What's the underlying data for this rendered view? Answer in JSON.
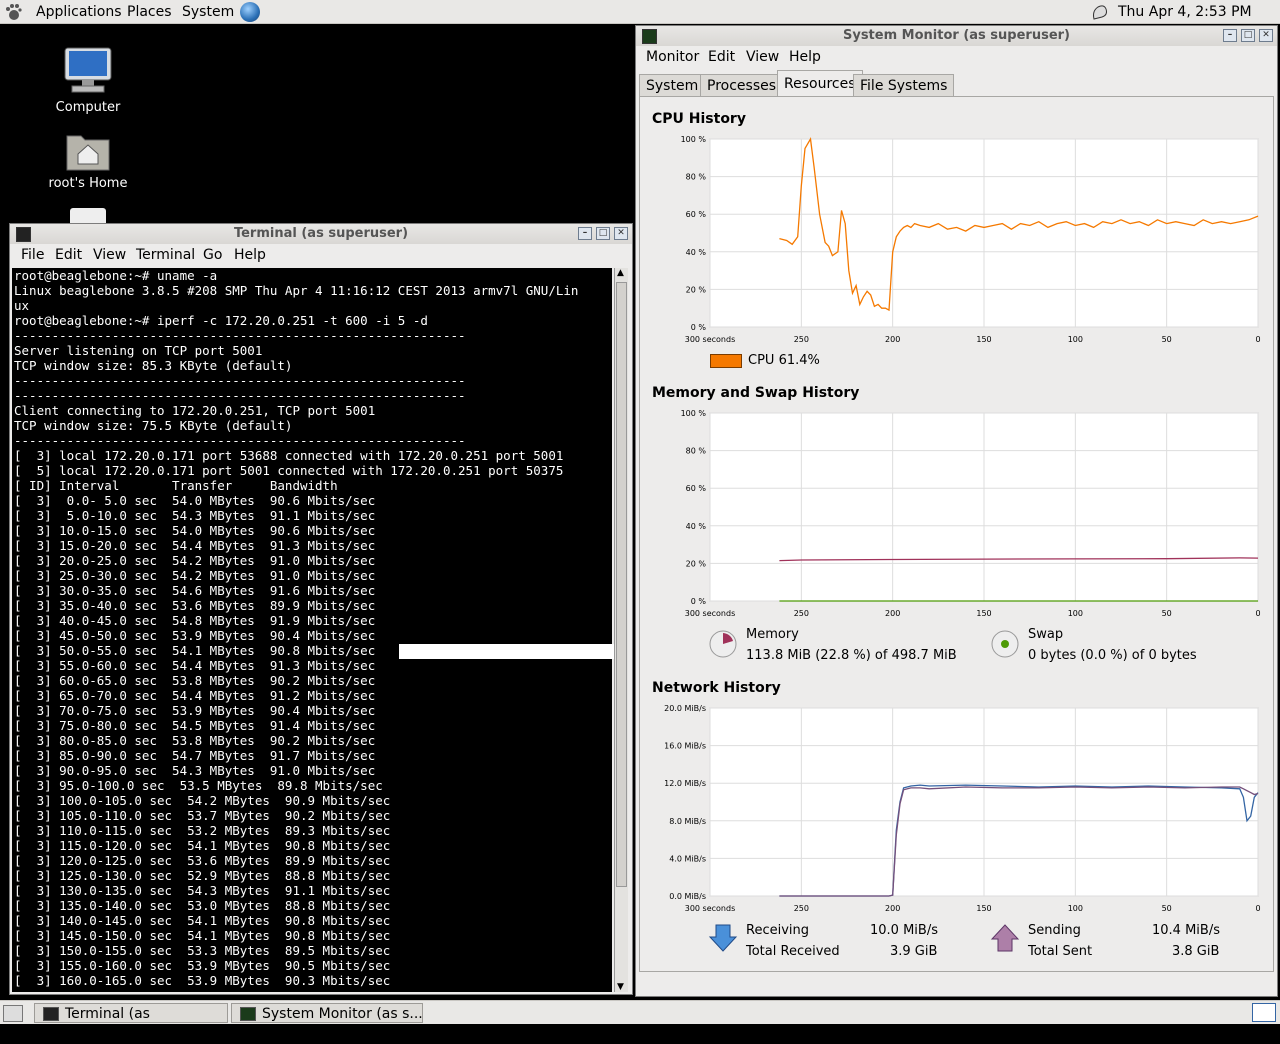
{
  "top_panel": {
    "menus": [
      "Applications",
      "Places",
      "System"
    ],
    "clock": "Thu Apr  4,  2:53 PM"
  },
  "desktop": {
    "icons": [
      {
        "label": "Computer"
      },
      {
        "label": "root's Home"
      }
    ]
  },
  "terminal": {
    "title": "Terminal (as superuser)",
    "menu": [
      "File",
      "Edit",
      "View",
      "Terminal",
      "Go",
      "Help"
    ],
    "lines": [
      "root@beaglebone:~# uname -a",
      "Linux beaglebone 3.8.5 #208 SMP Thu Apr 4 11:16:12 CEST 2013 armv7l GNU/Lin",
      "ux",
      "root@beaglebone:~# iperf -c 172.20.0.251 -t 600 -i 5 -d",
      "------------------------------------------------------------",
      "Server listening on TCP port 5001",
      "TCP window size: 85.3 KByte (default)",
      "------------------------------------------------------------",
      "------------------------------------------------------------",
      "Client connecting to 172.20.0.251, TCP port 5001",
      "TCP window size: 75.5 KByte (default)",
      "------------------------------------------------------------",
      "[  3] local 172.20.0.171 port 53688 connected with 172.20.0.251 port 5001",
      "[  5] local 172.20.0.171 port 5001 connected with 172.20.0.251 port 50375",
      "[ ID] Interval       Transfer     Bandwidth",
      "[  3]  0.0- 5.0 sec  54.0 MBytes  90.6 Mbits/sec",
      "[  3]  5.0-10.0 sec  54.3 MBytes  91.1 Mbits/sec",
      "[  3] 10.0-15.0 sec  54.0 MBytes  90.6 Mbits/sec",
      "[  3] 15.0-20.0 sec  54.4 MBytes  91.3 Mbits/sec",
      "[  3] 20.0-25.0 sec  54.2 MBytes  91.0 Mbits/sec",
      "[  3] 25.0-30.0 sec  54.2 MBytes  91.0 Mbits/sec",
      "[  3] 30.0-35.0 sec  54.6 MBytes  91.6 Mbits/sec",
      "[  3] 35.0-40.0 sec  53.6 MBytes  89.9 Mbits/sec",
      "[  3] 40.0-45.0 sec  54.8 MBytes  91.9 Mbits/sec",
      "[  3] 45.0-50.0 sec  53.9 MBytes  90.4 Mbits/sec",
      "[  3] 50.0-55.0 sec  54.1 MBytes  90.8 Mbits/sec",
      "[  3] 55.0-60.0 sec  54.4 MBytes  91.3 Mbits/sec",
      "[  3] 60.0-65.0 sec  53.8 MBytes  90.2 Mbits/sec",
      "[  3] 65.0-70.0 sec  54.4 MBytes  91.2 Mbits/sec",
      "[  3] 70.0-75.0 sec  53.9 MBytes  90.4 Mbits/sec",
      "[  3] 75.0-80.0 sec  54.5 MBytes  91.4 Mbits/sec",
      "[  3] 80.0-85.0 sec  53.8 MBytes  90.2 Mbits/sec",
      "[  3] 85.0-90.0 sec  54.7 MBytes  91.7 Mbits/sec",
      "[  3] 90.0-95.0 sec  54.3 MBytes  91.0 Mbits/sec",
      "[  3] 95.0-100.0 sec  53.5 MBytes  89.8 Mbits/sec",
      "[  3] 100.0-105.0 sec  54.2 MBytes  90.9 Mbits/sec",
      "[  3] 105.0-110.0 sec  53.7 MBytes  90.2 Mbits/sec",
      "[  3] 110.0-115.0 sec  53.2 MBytes  89.3 Mbits/sec",
      "[  3] 115.0-120.0 sec  54.1 MBytes  90.8 Mbits/sec",
      "[  3] 120.0-125.0 sec  53.6 MBytes  89.9 Mbits/sec",
      "[  3] 125.0-130.0 sec  52.9 MBytes  88.8 Mbits/sec",
      "[  3] 130.0-135.0 sec  54.3 MBytes  91.1 Mbits/sec",
      "[  3] 135.0-140.0 sec  53.0 MBytes  88.8 Mbits/sec",
      "[  3] 140.0-145.0 sec  54.1 MBytes  90.8 Mbits/sec",
      "[  3] 145.0-150.0 sec  54.1 MBytes  90.8 Mbits/sec",
      "[  3] 150.0-155.0 sec  53.3 MBytes  89.5 Mbits/sec",
      "[  3] 155.0-160.0 sec  53.9 MBytes  90.5 Mbits/sec",
      "[  3] 160.0-165.0 sec  53.9 MBytes  90.3 Mbits/sec"
    ]
  },
  "sysmon": {
    "title": "System Monitor (as superuser)",
    "menu": [
      "Monitor",
      "Edit",
      "View",
      "Help"
    ],
    "tabs": [
      "System",
      "Processes",
      "Resources",
      "File Systems"
    ],
    "active_tab": "Resources",
    "cpu_title": "CPU History",
    "mem_title": "Memory and Swap History",
    "net_title": "Network History",
    "cpu_legend": "CPU  61.4%",
    "memory_label": "Memory",
    "memory_value": "113.8 MiB (22.8 %) of 498.7 MiB",
    "swap_label": "Swap",
    "swap_value": "0 bytes (0.0 %) of 0 bytes",
    "receiving_label": "Receiving",
    "receiving_value": "10.0 MiB/s",
    "total_received_label": "Total Received",
    "total_received_value": "3.9 GiB",
    "sending_label": "Sending",
    "sending_value": "10.4 MiB/s",
    "total_sent_label": "Total Sent",
    "total_sent_value": "3.8 GiB",
    "colors": {
      "cpu": "#f57900",
      "memory": "#a0325a",
      "swap": "#4e9a06",
      "receiving": "#3465a4",
      "sending": "#75507b"
    }
  },
  "chart_data": [
    {
      "type": "line",
      "title": "CPU History",
      "x_ticks": [
        "300 seconds",
        "250",
        "200",
        "150",
        "100",
        "50",
        "0"
      ],
      "y_ticks": [
        "100 %",
        "80 %",
        "60 %",
        "40 %",
        "20 %",
        "0 %"
      ],
      "ylim": [
        0,
        100
      ],
      "xlim": [
        300,
        0
      ],
      "series": [
        {
          "name": "CPU",
          "x": [
            262,
            258,
            255,
            252,
            250,
            248,
            245,
            243,
            240,
            237,
            235,
            233,
            230,
            228,
            226,
            224,
            222,
            220,
            218,
            216,
            214,
            212,
            210,
            208,
            206,
            204,
            202,
            200,
            198,
            196,
            194,
            192,
            190,
            188,
            185,
            180,
            175,
            170,
            165,
            160,
            155,
            150,
            145,
            140,
            135,
            130,
            125,
            120,
            115,
            110,
            105,
            100,
            95,
            90,
            85,
            80,
            75,
            70,
            65,
            60,
            55,
            50,
            45,
            40,
            35,
            30,
            25,
            20,
            15,
            10,
            5,
            0
          ],
          "y": [
            47,
            46,
            44,
            48,
            75,
            95,
            100,
            85,
            60,
            45,
            43,
            38,
            40,
            62,
            55,
            30,
            18,
            22,
            12,
            16,
            19,
            17,
            11,
            12,
            10,
            10,
            9,
            40,
            48,
            51,
            53,
            54,
            53,
            55,
            54,
            53,
            55,
            52,
            53,
            51,
            54,
            53,
            54,
            55,
            52,
            55,
            54,
            56,
            53,
            55,
            56,
            54,
            55,
            53,
            56,
            55,
            57,
            55,
            56,
            54,
            57,
            55,
            56,
            55,
            54,
            57,
            55,
            56,
            55,
            56,
            57,
            59
          ]
        }
      ]
    },
    {
      "type": "line",
      "title": "Memory and Swap History",
      "x_ticks": [
        "300 seconds",
        "250",
        "200",
        "150",
        "100",
        "50",
        "0"
      ],
      "y_ticks": [
        "100 %",
        "80 %",
        "60 %",
        "40 %",
        "20 %",
        "0 %"
      ],
      "ylim": [
        0,
        100
      ],
      "xlim": [
        300,
        0
      ],
      "series": [
        {
          "name": "Memory",
          "x": [
            262,
            250,
            200,
            150,
            100,
            50,
            10,
            0
          ],
          "y": [
            21.5,
            21.8,
            22.1,
            22.3,
            22.4,
            22.5,
            22.9,
            22.8
          ]
        },
        {
          "name": "Swap",
          "x": [
            262,
            0
          ],
          "y": [
            0,
            0
          ]
        }
      ]
    },
    {
      "type": "line",
      "title": "Network History",
      "x_ticks": [
        "300 seconds",
        "250",
        "200",
        "150",
        "100",
        "50",
        "0"
      ],
      "y_ticks": [
        "20.0 MiB/s",
        "16.0 MiB/s",
        "12.0 MiB/s",
        "8.0 MiB/s",
        "4.0 MiB/s",
        "0.0 MiB/s"
      ],
      "ylim": [
        0,
        20
      ],
      "xlim": [
        300,
        0
      ],
      "series": [
        {
          "name": "Receiving",
          "x": [
            262,
            220,
            202,
            200,
            198,
            196,
            194,
            190,
            185,
            180,
            160,
            140,
            120,
            100,
            80,
            60,
            40,
            20,
            10,
            8,
            6,
            4,
            2,
            0
          ],
          "y": [
            0,
            0,
            0,
            0.1,
            7,
            10,
            11.5,
            11.7,
            11.8,
            11.7,
            11.8,
            11.7,
            11.6,
            11.7,
            11.6,
            11.7,
            11.6,
            11.5,
            11.4,
            10.5,
            8,
            8.5,
            10.5,
            11
          ]
        },
        {
          "name": "Sending",
          "x": [
            262,
            220,
            202,
            200,
            198,
            196,
            194,
            190,
            185,
            180,
            160,
            140,
            120,
            100,
            80,
            60,
            40,
            20,
            10,
            8,
            6,
            4,
            2,
            0
          ],
          "y": [
            0,
            0,
            0,
            0.1,
            6.5,
            9.8,
            11.3,
            11.5,
            11.5,
            11.4,
            11.6,
            11.5,
            11.5,
            11.6,
            11.5,
            11.6,
            11.5,
            11.6,
            11.6,
            11.4,
            11.2,
            11,
            10.8,
            10.9
          ]
        }
      ]
    }
  ]
}
